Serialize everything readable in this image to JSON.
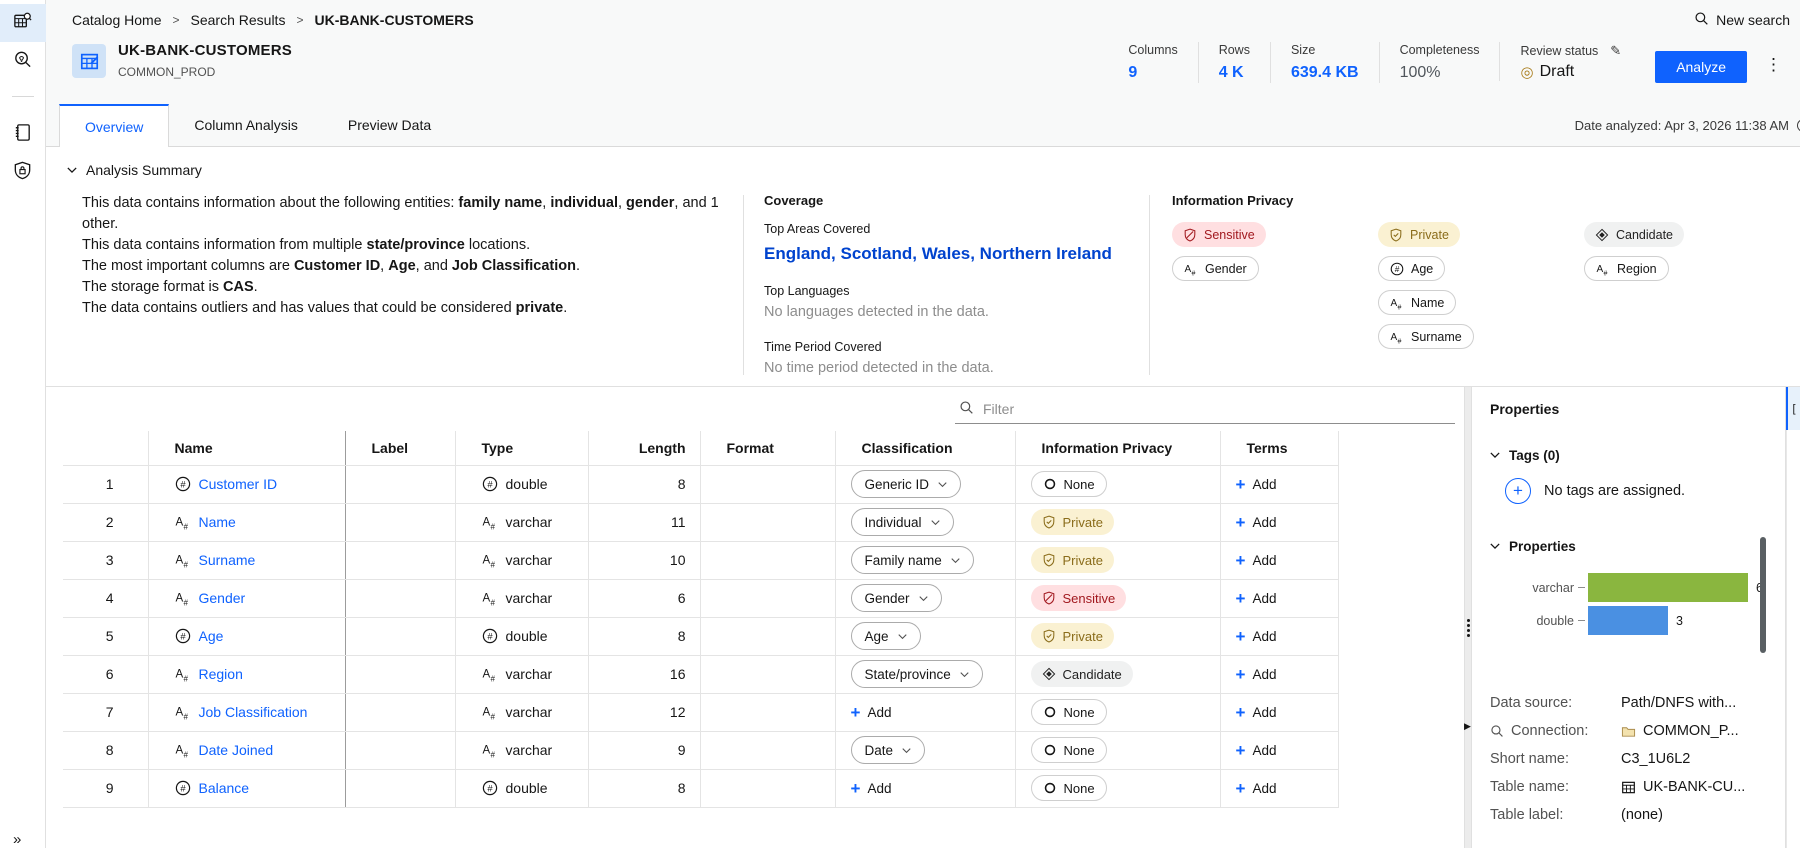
{
  "colors": {
    "accent": "#0f62fe",
    "link": "#0043ce",
    "sensitive_bg": "#ffdfe1",
    "sensitive_text": "#a2191f",
    "private_bg": "#faf1d2",
    "private_text": "#8a6c1a",
    "candidate_bg": "#f0f1f1",
    "bar_varchar": "#8ab63f",
    "bar_double": "#4a90e2",
    "draft_icon": "#a97d1c"
  },
  "sidebar": {
    "items": [
      {
        "icon": "catalog-search-icon",
        "active": true
      },
      {
        "icon": "insights-search-icon",
        "active": false
      },
      {
        "icon": "notebook-icon",
        "active": false
      },
      {
        "icon": "governance-shield-icon",
        "active": false
      }
    ],
    "collapse_glyph": "»"
  },
  "breadcrumb": [
    "Catalog Home",
    "Search Results",
    "UK-BANK-CUSTOMERS"
  ],
  "new_search_label": "New search",
  "asset": {
    "title": "UK-BANK-CUSTOMERS",
    "schema": "COMMON_PROD",
    "stats": [
      {
        "label": "Columns",
        "value": "9",
        "style": "blue"
      },
      {
        "label": "Rows",
        "value": "4 K",
        "style": "blue"
      },
      {
        "label": "Size",
        "value": "639.4 KB",
        "style": "blue"
      },
      {
        "label": "Completeness",
        "value": "100%",
        "style": "dark"
      }
    ],
    "review_status_label": "Review status",
    "review_status_value": "Draft",
    "analyze_label": "Analyze",
    "overflow_glyph": "⋮"
  },
  "tabs": [
    {
      "label": "Overview",
      "active": true
    },
    {
      "label": "Column Analysis",
      "active": false
    },
    {
      "label": "Preview Data",
      "active": false
    }
  ],
  "date_analyzed": "Date analyzed: Apr 3, 2026 11:38 AM",
  "summary": {
    "section_title": "Analysis Summary",
    "lines": [
      [
        {
          "t": "This data contains information about the following entities: "
        },
        {
          "t": "family name",
          "b": 1
        },
        {
          "t": ", "
        },
        {
          "t": "individual",
          "b": 1
        },
        {
          "t": ", "
        },
        {
          "t": "gender",
          "b": 1
        },
        {
          "t": ", and 1 other."
        }
      ],
      [
        {
          "t": "This data contains information from multiple "
        },
        {
          "t": "state/province",
          "b": 1
        },
        {
          "t": " locations."
        }
      ],
      [
        {
          "t": "The most important columns are "
        },
        {
          "t": "Customer ID",
          "b": 1
        },
        {
          "t": ", "
        },
        {
          "t": "Age",
          "b": 1
        },
        {
          "t": ", and "
        },
        {
          "t": "Job Classification",
          "b": 1
        },
        {
          "t": "."
        }
      ],
      [
        {
          "t": "The storage format is "
        },
        {
          "t": "CAS",
          "b": 1
        },
        {
          "t": "."
        }
      ],
      [
        {
          "t": "The data contains outliers and has values that could be considered "
        },
        {
          "t": "private",
          "b": 1
        },
        {
          "t": "."
        }
      ]
    ],
    "coverage": {
      "title": "Coverage",
      "areas_label": "Top Areas Covered",
      "areas_value": "England, Scotland, Wales, Northern Ireland",
      "languages_label": "Top Languages",
      "languages_value": "No languages detected in the data.",
      "period_label": "Time Period Covered",
      "period_value": "No time period detected in the data."
    },
    "privacy": {
      "title": "Information Privacy",
      "columns": [
        [
          {
            "label": "Sensitive",
            "kind": "sensitive"
          },
          {
            "label": "Gender",
            "kind": "plain",
            "icon": "varchar"
          }
        ],
        [
          {
            "label": "Private",
            "kind": "private"
          },
          {
            "label": "Age",
            "kind": "plain",
            "icon": "double"
          },
          {
            "label": "Name",
            "kind": "plain",
            "icon": "varchar"
          },
          {
            "label": "Surname",
            "kind": "plain",
            "icon": "varchar"
          }
        ],
        [
          {
            "label": "Candidate",
            "kind": "candidate"
          },
          {
            "label": "Region",
            "kind": "plain",
            "icon": "varchar"
          }
        ]
      ]
    }
  },
  "table": {
    "filter_placeholder": "Filter",
    "headers": [
      "Name",
      "Label",
      "Type",
      "Length",
      "Format",
      "Classification",
      "Information Privacy",
      "Terms"
    ],
    "add_label": "Add",
    "rows": [
      {
        "num": "1",
        "name": "Customer ID",
        "type": "double",
        "length": "8",
        "classification": "Generic ID",
        "privacy": "None"
      },
      {
        "num": "2",
        "name": "Name",
        "type": "varchar",
        "length": "11",
        "classification": "Individual",
        "privacy": "Private"
      },
      {
        "num": "3",
        "name": "Surname",
        "type": "varchar",
        "length": "10",
        "classification": "Family name",
        "privacy": "Private"
      },
      {
        "num": "4",
        "name": "Gender",
        "type": "varchar",
        "length": "6",
        "classification": "Gender",
        "privacy": "Sensitive"
      },
      {
        "num": "5",
        "name": "Age",
        "type": "double",
        "length": "8",
        "classification": "Age",
        "privacy": "Private"
      },
      {
        "num": "6",
        "name": "Region",
        "type": "varchar",
        "length": "16",
        "classification": "State/province",
        "privacy": "Candidate"
      },
      {
        "num": "7",
        "name": "Job Classification",
        "type": "varchar",
        "length": "12",
        "classification": null,
        "privacy": "None"
      },
      {
        "num": "8",
        "name": "Date Joined",
        "type": "varchar",
        "length": "9",
        "classification": "Date",
        "privacy": "None"
      },
      {
        "num": "9",
        "name": "Balance",
        "type": "double",
        "length": "8",
        "classification": null,
        "privacy": "None"
      }
    ]
  },
  "properties_panel": {
    "title": "Properties",
    "tags_section_title": "Tags (0)",
    "no_tags_text": "No tags are assigned.",
    "properties_section_title": "Properties",
    "chart_data": {
      "type": "bar",
      "orientation": "horizontal",
      "categories": [
        "varchar",
        "double"
      ],
      "values": [
        6,
        3
      ],
      "colors": [
        "#8ab63f",
        "#4a90e2"
      ],
      "xlim": [
        0,
        6
      ],
      "title": "",
      "xlabel": "",
      "ylabel": ""
    },
    "kv": [
      {
        "label": "Data source:",
        "value": "Path/DNFS with...",
        "label_icon": null,
        "value_icon": null
      },
      {
        "label": "Connection:",
        "value": "COMMON_P...",
        "label_icon": "search",
        "value_icon": "folder"
      },
      {
        "label": "Short name:",
        "value": "C3_1U6L2",
        "label_icon": null,
        "value_icon": null
      },
      {
        "label": "Table name:",
        "value": "UK-BANK-CU...",
        "label_icon": null,
        "value_icon": "table"
      },
      {
        "label": "Table label:",
        "value": "(none)",
        "label_icon": null,
        "value_icon": null
      }
    ]
  },
  "right_rail_glyph": "["
}
